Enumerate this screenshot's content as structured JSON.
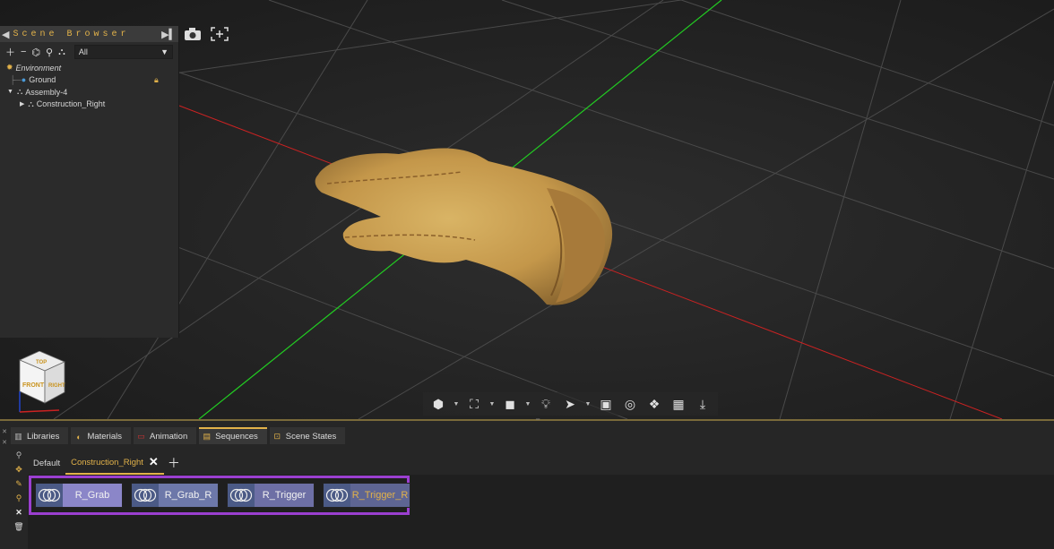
{
  "scene_browser": {
    "title": "Scene Browser",
    "filter_value": "All",
    "tree": [
      {
        "label": "Environment",
        "icon": "sun-icon"
      },
      {
        "label": "Ground",
        "icon": "globe-icon",
        "locked": true
      },
      {
        "label": "Assembly-4",
        "icon": "assembly-icon",
        "expanded": true
      },
      {
        "label": "Construction_Right",
        "icon": "assembly-icon",
        "expanded": false
      }
    ]
  },
  "navcube": {
    "top": "TOP",
    "front": "FRONT",
    "right": "RIGHT"
  },
  "dock": {
    "tabs": [
      {
        "label": "Libraries",
        "icon": "books-icon",
        "active": false
      },
      {
        "label": "Materials",
        "icon": "palette-icon",
        "active": false
      },
      {
        "label": "Animation",
        "icon": "film-icon",
        "active": false
      },
      {
        "label": "Sequences",
        "icon": "clapper-icon",
        "active": true
      },
      {
        "label": "Scene States",
        "icon": "scene-states-icon",
        "active": false
      }
    ],
    "sequence_tabs": [
      {
        "label": "Default",
        "active": false
      },
      {
        "label": "Construction_Right",
        "active": true
      }
    ],
    "sequences": [
      {
        "name": "R_Grab"
      },
      {
        "name": "R_Grab_R"
      },
      {
        "name": "R_Trigger"
      },
      {
        "name": "R_Trigger_R"
      }
    ]
  },
  "colors": {
    "accent": "#e2b24a",
    "highlight_border": "#9b3fd0",
    "x_axis": "#cc2222",
    "y_axis": "#22cc22"
  }
}
